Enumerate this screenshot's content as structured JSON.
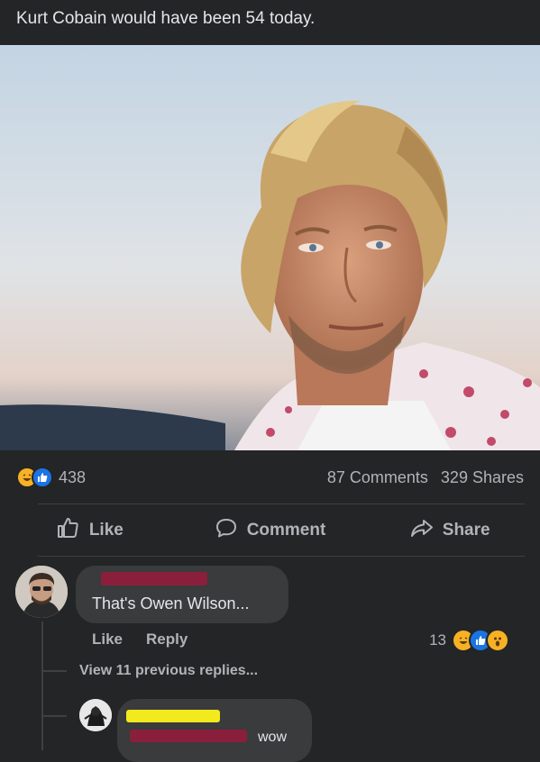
{
  "post": {
    "text": "Kurt Cobain would have been 54 today."
  },
  "stats": {
    "reaction_count": "438",
    "comments": "87 Comments",
    "shares": "329 Shares"
  },
  "actions": {
    "like": "Like",
    "comment": "Comment",
    "share": "Share"
  },
  "comment": {
    "text": "That's Owen Wilson...",
    "like": "Like",
    "reply": "Reply",
    "reaction_count": "13",
    "view_replies": "View 11 previous replies..."
  },
  "reply": {
    "text": "wow"
  },
  "colors": {
    "background": "#242526",
    "bubble": "#3a3b3c",
    "muted_text": "#b0b3b8",
    "like_blue": "#1b74e4",
    "haha_yellow": "#f7b125"
  }
}
